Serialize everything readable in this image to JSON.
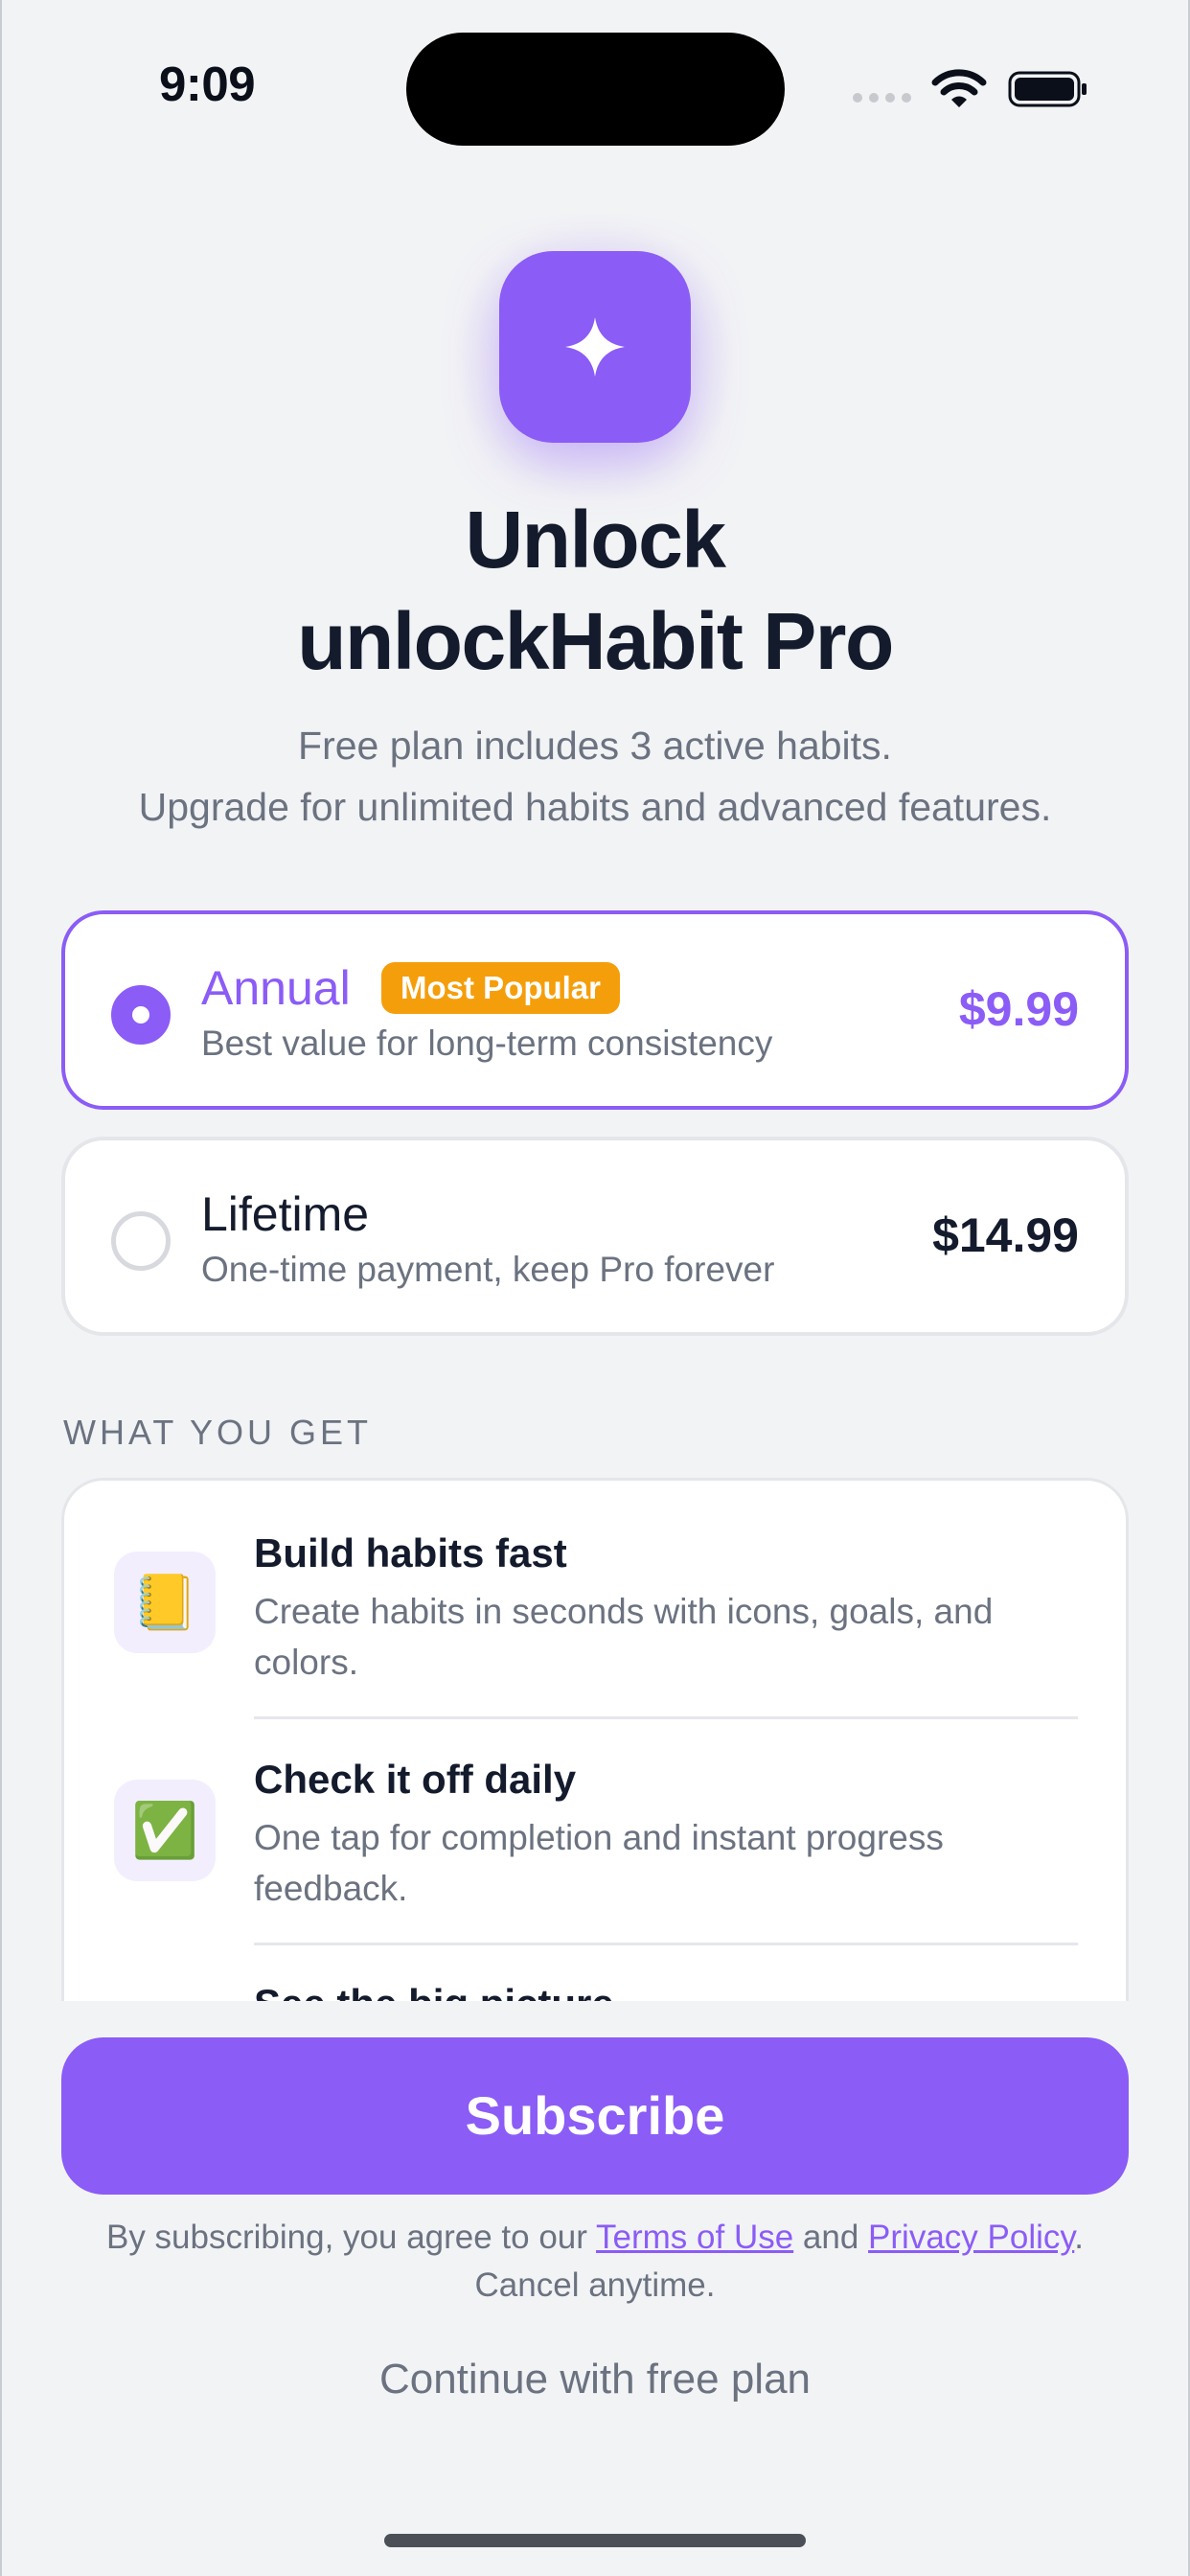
{
  "status_bar": {
    "time": "9:09"
  },
  "hero": {
    "icon": "sparkle-icon",
    "title_line1": "Unlock",
    "title_line2": "unlockHabit Pro",
    "subtitle_line1": "Free plan includes 3 active habits.",
    "subtitle_line2": "Upgrade for unlimited habits and advanced features."
  },
  "plans": [
    {
      "name": "Annual",
      "badge": "Most Popular",
      "description": "Best value for long-term consistency",
      "price": "$9.99",
      "selected": true
    },
    {
      "name": "Lifetime",
      "description": "One-time payment, keep Pro forever",
      "price": "$14.99",
      "selected": false
    }
  ],
  "features_section": {
    "label": "WHAT YOU GET",
    "items": [
      {
        "icon": "notebook-icon",
        "emoji": "📒",
        "title": "Build habits fast",
        "desc_line1": "Create habits in seconds with icons, goals, and",
        "desc_line2": "colors."
      },
      {
        "icon": "checkmark-icon",
        "emoji": "✅",
        "title": "Check it off daily",
        "desc_line1": "One tap for completion and instant progress",
        "desc_line2": "feedback."
      },
      {
        "title": "See the big picture"
      }
    ]
  },
  "cta": {
    "subscribe_label": "Subscribe"
  },
  "legal": {
    "prefix": "By subscribing, you agree to our ",
    "terms_label": "Terms of Use",
    "and": " and ",
    "privacy_label": "Privacy Policy",
    "suffix": ".",
    "line2": "Cancel anytime."
  },
  "free_plan_label": "Continue with free plan",
  "colors": {
    "accent": "#8b5cf6",
    "badge": "#f59e0b",
    "background": "#f2f3f5"
  }
}
